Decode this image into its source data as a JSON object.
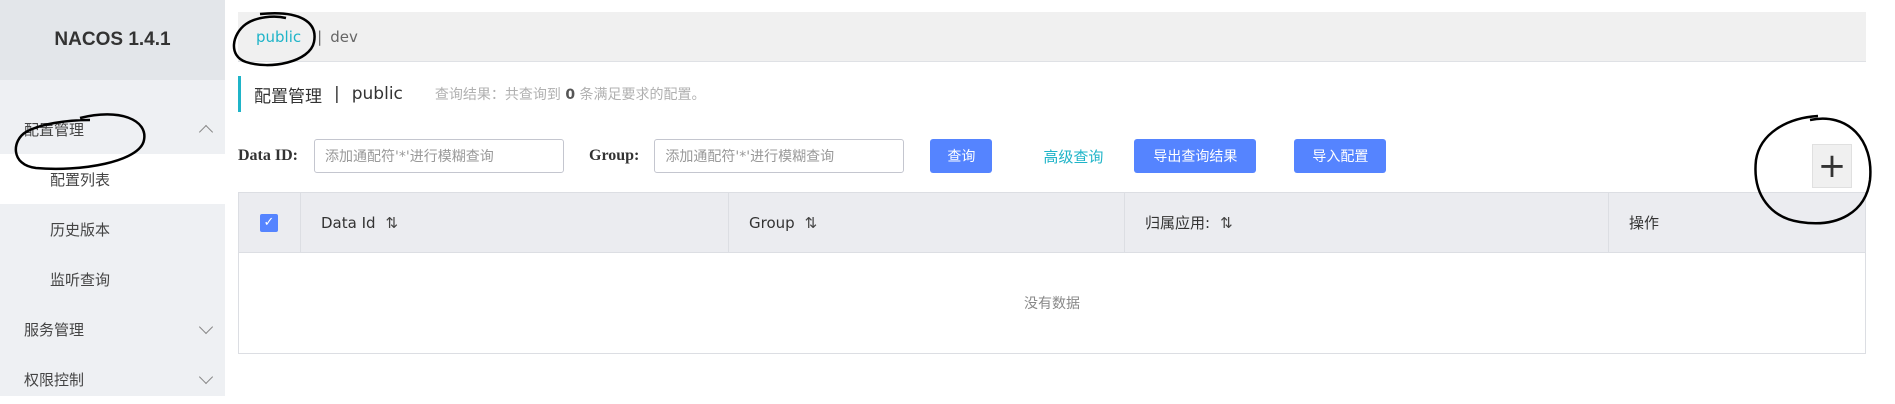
{
  "app": {
    "title": "NACOS 1.4.1"
  },
  "sidebar": {
    "groups": [
      {
        "label": "配置管理",
        "expanded": true,
        "items": [
          {
            "label": "配置列表",
            "active": true
          },
          {
            "label": "历史版本"
          },
          {
            "label": "监听查询"
          }
        ]
      },
      {
        "label": "服务管理",
        "expanded": false
      },
      {
        "label": "权限控制",
        "expanded": false
      }
    ]
  },
  "namespaces": {
    "active": "public",
    "separator": "|",
    "other": "dev"
  },
  "page": {
    "title": "配置管理",
    "separator": "|",
    "namespace": "public",
    "result_prefix": "查询结果：共查询到",
    "result_count": "0",
    "result_suffix": "条满足要求的配置。"
  },
  "search": {
    "data_id_label": "Data ID:",
    "data_id_placeholder": "添加通配符'*'进行模糊查询",
    "group_label": "Group:",
    "group_placeholder": "添加通配符'*'进行模糊查询",
    "query_button": "查询",
    "advanced_link": "高级查询",
    "export_button": "导出查询结果",
    "import_button": "导入配置",
    "add_button": "+"
  },
  "table": {
    "columns": [
      "Data Id",
      "Group",
      "归属应用:",
      "操作"
    ],
    "sort_icon": "⇅",
    "empty_text": "没有数据"
  },
  "colors": {
    "accent": "#1fb4c8",
    "primary": "#5584ff",
    "sidebar_bg": "#eef0f3"
  }
}
